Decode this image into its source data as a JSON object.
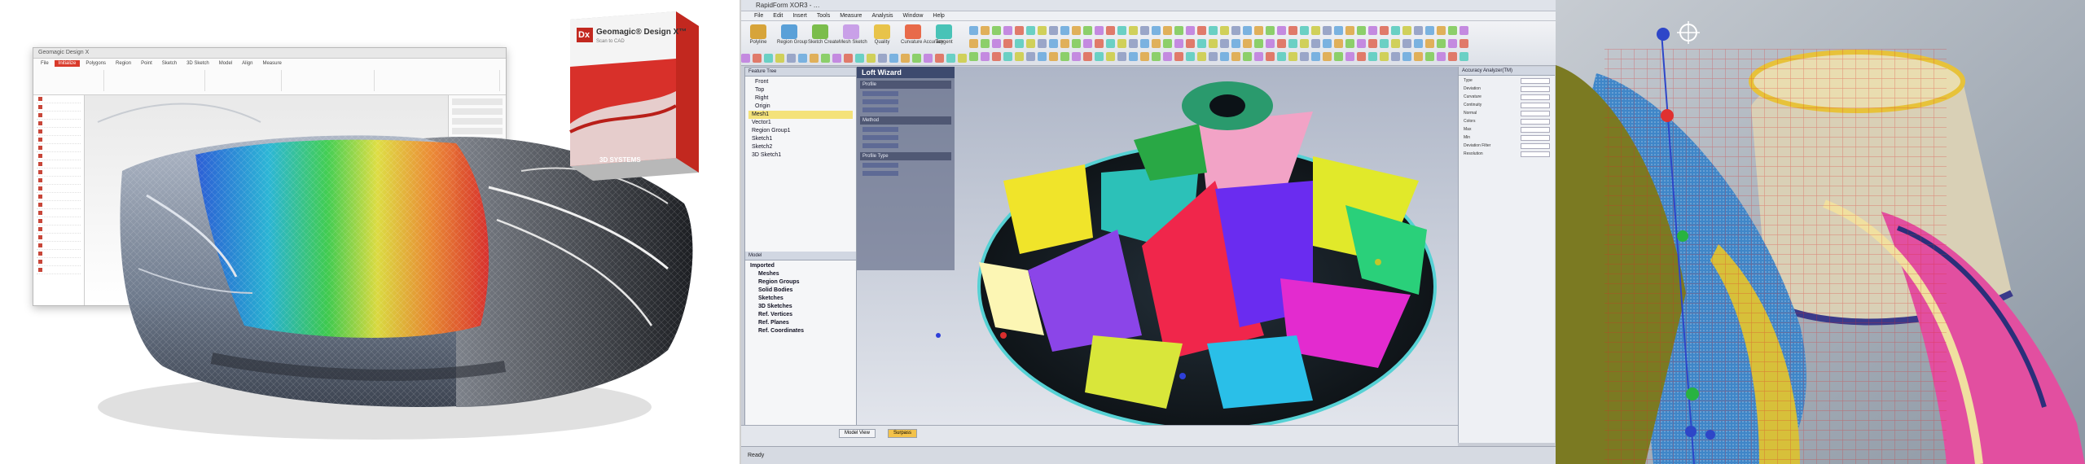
{
  "panel1": {
    "product_box": {
      "logo": "Dx",
      "name": "Geomagic® Design X™",
      "tagline": "Scan to CAD",
      "vendor": "3D SYSTEMS"
    },
    "mini_app": {
      "title": "Geomagic Design X",
      "ribbon_tabs": [
        "File",
        "Initialize",
        "Polygons",
        "Region",
        "Point",
        "Sketch",
        "3D Sketch",
        "Model",
        "Align",
        "Measure"
      ],
      "active_tab": "Initialize"
    },
    "colors": {
      "brand_red": "#d93a2b"
    }
  },
  "panel2": {
    "title": "RapidForm XOR3 - …",
    "menu": [
      "File",
      "Edit",
      "Insert",
      "Tools",
      "Measure",
      "Analysis",
      "Window",
      "Help"
    ],
    "toolbar_buttons": [
      "Polyline",
      "Region Group",
      "Sketch Create",
      "Mesh Sketch",
      "Quality",
      "Curvature Accuracy",
      "Tangent"
    ],
    "tree": [
      "Front",
      "Top",
      "Right",
      "Origin",
      "Mesh1",
      "Vector1",
      "Region Group1",
      "Sketch1",
      "Sketch2",
      "3D Sketch1"
    ],
    "tree2_header": "Model",
    "tree2": [
      "Imported",
      "Meshes",
      "Region Groups",
      "Solid Bodies",
      "Sketches",
      "3D Sketches",
      "Ref. Vertices",
      "Ref. Planes",
      "Ref. Coordinates"
    ],
    "wizard": {
      "title": "Loft Wizard",
      "sections": [
        "Profile",
        "Method",
        "Profile Type"
      ]
    },
    "right_panel": {
      "title": "Accuracy Analyzer(TM)",
      "rows": [
        "Type",
        "Deviation",
        "Curvature",
        "Continuity",
        "Normal",
        "Colors",
        "Max",
        "Min",
        "Deviation Filter",
        "Resolution"
      ]
    },
    "status_tabs": [
      "Model View",
      "Surpass"
    ],
    "active_status_tab": "Surpass",
    "status_text": "Ready"
  },
  "panel3": {}
}
